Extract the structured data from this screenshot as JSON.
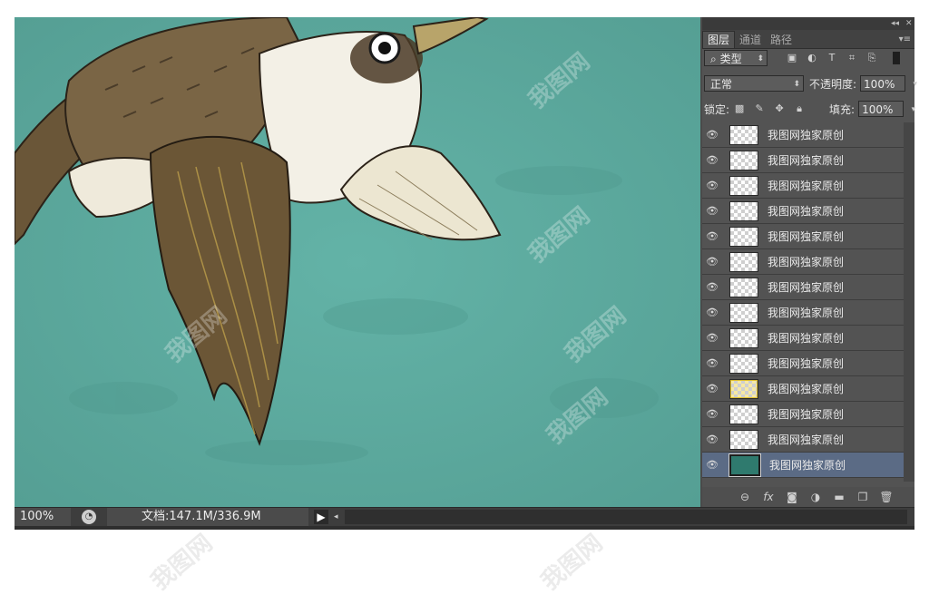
{
  "layers_panel": {
    "collapse_label": "◂◂",
    "close_label": "✕",
    "tabs": [
      {
        "label": "图层",
        "active": true
      },
      {
        "label": "通道",
        "active": false
      },
      {
        "label": "路径",
        "active": false
      }
    ],
    "filter": {
      "search_glyph": "⌕",
      "kind_label": "类型"
    },
    "blend_mode": "正常",
    "opacity_label": "不透明度:",
    "opacity_value": "100%",
    "lock_label": "锁定:",
    "fill_label": "填充:",
    "fill_value": "100%",
    "layers": [
      {
        "name": "我图网独家原创",
        "thumb": "transparent",
        "active": false
      },
      {
        "name": "我图网独家原创",
        "thumb": "transparent",
        "active": false
      },
      {
        "name": "我图网独家原创",
        "thumb": "transparent",
        "active": false
      },
      {
        "name": "我图网独家原创",
        "thumb": "transparent",
        "active": false
      },
      {
        "name": "我图网独家原创",
        "thumb": "transparent",
        "active": false
      },
      {
        "name": "我图网独家原创",
        "thumb": "transparent",
        "active": false
      },
      {
        "name": "我图网独家原创",
        "thumb": "transparent",
        "active": false
      },
      {
        "name": "我图网独家原创",
        "thumb": "transparent",
        "active": false
      },
      {
        "name": "我图网独家原创",
        "thumb": "transparent",
        "active": false
      },
      {
        "name": "我图网独家原创",
        "thumb": "transparent",
        "active": false
      },
      {
        "name": "我图网独家原创",
        "thumb": "yellow",
        "active": false
      },
      {
        "name": "我图网独家原创",
        "thumb": "transparent",
        "active": false
      },
      {
        "name": "我图网独家原创",
        "thumb": "transparent",
        "active": false
      },
      {
        "name": "我图网独家原创",
        "thumb": "teal",
        "active": true
      }
    ],
    "footer_icons": [
      "link-layers-icon",
      "fx-icon",
      "add-mask-icon",
      "adjustment-layer-icon",
      "new-group-icon",
      "new-layer-icon",
      "delete-layer-icon"
    ]
  },
  "status_bar": {
    "zoom": "100%",
    "doc_info": "文档:147.1M/336.9M"
  },
  "watermark_text": "我图网",
  "colors": {
    "canvas_bg": "#5eada1",
    "panel_bg": "#535353",
    "active_layer": "#5b6b85"
  }
}
